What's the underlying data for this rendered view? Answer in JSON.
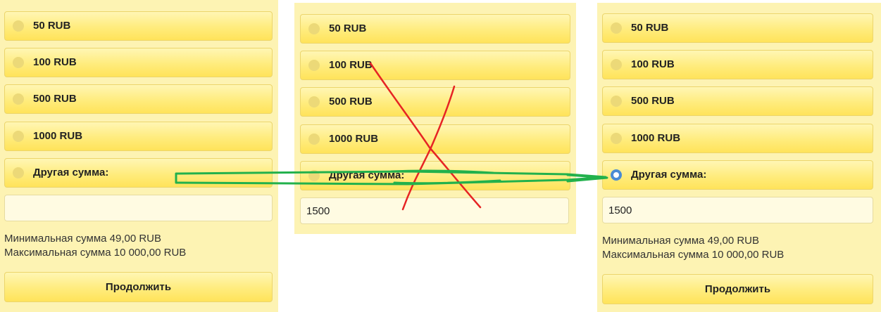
{
  "left": {
    "options": [
      "50 RUB",
      "100 RUB",
      "500 RUB",
      "1000 RUB",
      "Другая сумма:"
    ],
    "custom_amount_value": "",
    "min_amount": "Минимальная сумма 49,00 RUB",
    "max_amount": "Максимальная сумма 10 000,00 RUB",
    "continue_label": "Продолжить"
  },
  "middle": {
    "options": [
      "50 RUB",
      "100 RUB",
      "500 RUB",
      "1000 RUB",
      "Другая сумма:"
    ],
    "custom_amount_value": "1500"
  },
  "right": {
    "options": [
      "50 RUB",
      "100 RUB",
      "500 RUB",
      "1000 RUB",
      "Другая сумма:"
    ],
    "selected_option": "Другая сумма:",
    "custom_amount_value": "1500",
    "min_amount": "Минимальная сумма 49,00 RUB",
    "max_amount": "Максимальная сумма 10 000,00 RUB",
    "continue_label": "Продолжить"
  },
  "annotations": {
    "cross_color": "#e62424",
    "arrow_color": "#22b14c"
  }
}
